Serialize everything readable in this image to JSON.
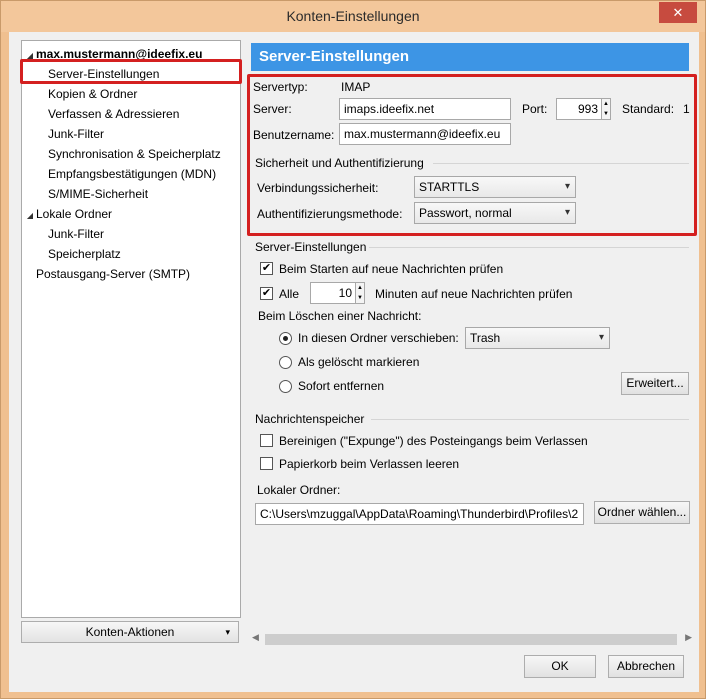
{
  "window": {
    "title": "Konten-Einstellungen",
    "close_label": "✕"
  },
  "tree": {
    "items": [
      {
        "label": "max.mustermann@ideefix.eu",
        "twisty": "◢"
      },
      {
        "label": "Server-Einstellungen"
      },
      {
        "label": "Kopien & Ordner"
      },
      {
        "label": "Verfassen & Adressieren"
      },
      {
        "label": "Junk-Filter"
      },
      {
        "label": "Synchronisation & Speicherplatz"
      },
      {
        "label": "Empfangsbestätigungen (MDN)"
      },
      {
        "label": "S/MIME-Sicherheit"
      },
      {
        "label": "Lokale Ordner",
        "twisty": "◢"
      },
      {
        "label": "Junk-Filter"
      },
      {
        "label": "Speicherplatz"
      },
      {
        "label": "Postausgang-Server (SMTP)"
      }
    ]
  },
  "konten_aktionen": {
    "label": "Konten-Aktionen",
    "arrow": "▾"
  },
  "panel": {
    "heading": "Server-Einstellungen",
    "servertyp_label": "Servertyp:",
    "servertyp_value": "IMAP",
    "server_label": "Server:",
    "server_value": "imaps.ideefix.net",
    "port_label": "Port:",
    "port_value": "993",
    "standard_label": "Standard:",
    "standard_value": "1",
    "benutzer_label": "Benutzername:",
    "benutzer_value": "max.mustermann@ideefix.eu",
    "security_group": "Sicherheit und Authentifizierung",
    "verbindung_label": "Verbindungssicherheit:",
    "verbindung_value": "STARTTLS",
    "auth_label": "Authentifizierungsmethode:",
    "auth_value": "Passwort, normal",
    "server_group": "Server-Einstellungen",
    "check_start_label": "Beim Starten auf neue Nachrichten prüfen",
    "check_all_label": "Alle",
    "minutes_value": "10",
    "minutes_label": "Minuten auf neue Nachrichten prüfen",
    "delete_label": "Beim Löschen einer Nachricht:",
    "radio_move_label": "In diesen Ordner verschieben:",
    "trash_value": "Trash",
    "radio_mark_label": "Als gelöscht markieren",
    "radio_remove_label": "Sofort entfernen",
    "erweitert_label": "Erweitert...",
    "store_group": "Nachrichtenspeicher",
    "expunge_label": "Bereinigen (\"Expunge\") des Posteingangs beim Verlassen",
    "trash_empty_label": "Papierkorb beim Verlassen leeren",
    "local_folder_label": "Lokaler Ordner:",
    "local_folder_value": "C:\\Users\\mzuggal\\AppData\\Roaming\\Thunderbird\\Profiles\\2",
    "folder_choose_label": "Ordner wählen..."
  },
  "footer": {
    "ok_label": "OK",
    "cancel_label": "Abbrechen"
  },
  "icons": {
    "check": "✔",
    "spin_up": "▲",
    "spin_down": "▼",
    "chevron": "▾"
  }
}
